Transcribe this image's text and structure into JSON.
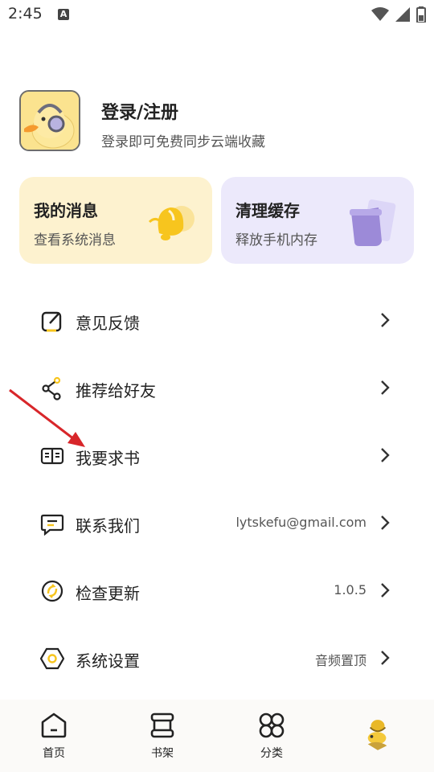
{
  "status_bar": {
    "time": "2:45",
    "a_badge": "A"
  },
  "profile": {
    "title": "登录/注册",
    "subtitle": "登录即可免费同步云端收藏"
  },
  "cards": [
    {
      "title": "我的消息",
      "subtitle": "查看系统消息",
      "icon": "bell-icon"
    },
    {
      "title": "清理缓存",
      "subtitle": "释放手机内存",
      "icon": "trash-icon"
    }
  ],
  "menu": [
    {
      "label": "意见反馈",
      "value": "",
      "icon": "feedback-icon"
    },
    {
      "label": "推荐给好友",
      "value": "",
      "icon": "share-icon"
    },
    {
      "label": "我要求书",
      "value": "",
      "icon": "book-icon"
    },
    {
      "label": "联系我们",
      "value": "lytskefu@gmail.com",
      "icon": "message-icon"
    },
    {
      "label": "检查更新",
      "value": "1.0.5",
      "icon": "update-icon"
    },
    {
      "label": "系统设置",
      "value": "音频置顶",
      "icon": "settings-icon"
    }
  ],
  "bottom_nav": [
    {
      "label": "首页",
      "icon": "home-icon"
    },
    {
      "label": "书架",
      "icon": "bookshelf-icon"
    },
    {
      "label": "分类",
      "icon": "category-icon"
    },
    {
      "label": "",
      "icon": "profile-icon"
    }
  ],
  "colors": {
    "message_card_bg": "#fdf2cf",
    "cache_card_bg": "#ece9fb",
    "accent_yellow": "#f7c51e",
    "accent_purple": "#9c8ad8",
    "annotation_red": "#d8262a"
  }
}
